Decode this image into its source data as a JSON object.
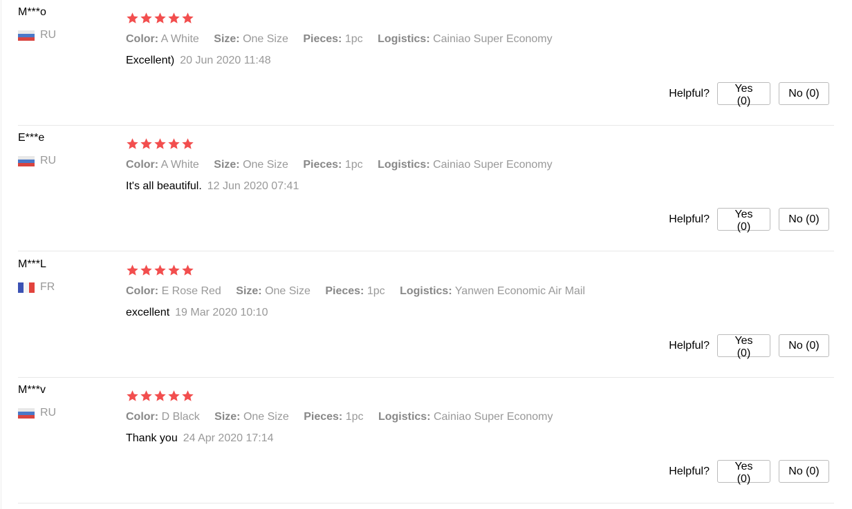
{
  "rating_color": "#f24e4e",
  "helpful_label": "Helpful?",
  "reviews": [
    {
      "user": "M***o",
      "country": "RU",
      "flag": "ru",
      "rating": 5,
      "color_key": "Color:",
      "color_val": "A White",
      "size_key": "Size:",
      "size_val": "One Size",
      "pieces_key": "Pieces:",
      "pieces_val": "1pc",
      "logistics_key": "Logistics:",
      "logistics_val": "Cainiao Super Economy",
      "comment": "Excellent)",
      "date": "20 Jun 2020 11:48",
      "yes": "Yes (0)",
      "no": "No (0)"
    },
    {
      "user": "E***e",
      "country": "RU",
      "flag": "ru",
      "rating": 5,
      "color_key": "Color:",
      "color_val": "A White",
      "size_key": "Size:",
      "size_val": "One Size",
      "pieces_key": "Pieces:",
      "pieces_val": "1pc",
      "logistics_key": "Logistics:",
      "logistics_val": "Cainiao Super Economy",
      "comment": "It's all beautiful.",
      "date": "12 Jun 2020 07:41",
      "yes": "Yes (0)",
      "no": "No (0)"
    },
    {
      "user": "M***L",
      "country": "FR",
      "flag": "fr",
      "rating": 5,
      "color_key": "Color:",
      "color_val": "E Rose Red",
      "size_key": "Size:",
      "size_val": "One Size",
      "pieces_key": "Pieces:",
      "pieces_val": "1pc",
      "logistics_key": "Logistics:",
      "logistics_val": "Yanwen Economic Air Mail",
      "comment": "excellent",
      "date": "19 Mar 2020 10:10",
      "yes": "Yes (0)",
      "no": "No (0)"
    },
    {
      "user": "M***v",
      "country": "RU",
      "flag": "ru",
      "rating": 5,
      "color_key": "Color:",
      "color_val": "D Black",
      "size_key": "Size:",
      "size_val": "One Size",
      "pieces_key": "Pieces:",
      "pieces_val": "1pc",
      "logistics_key": "Logistics:",
      "logistics_val": "Cainiao Super Economy",
      "comment": "Thank you",
      "date": "24 Apr 2020 17:14",
      "yes": "Yes (0)",
      "no": "No (0)"
    }
  ]
}
